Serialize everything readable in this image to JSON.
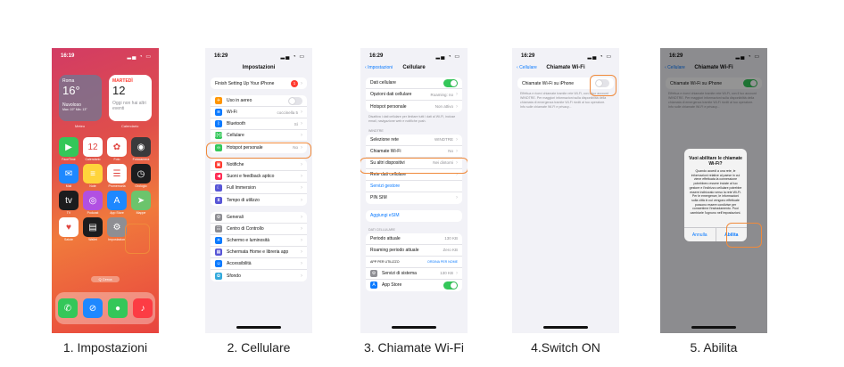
{
  "captions": [
    "1. Impostazioni",
    "2. Cellulare",
    "3. Chiamate Wi-Fi",
    "4.Switch ON",
    "5. Abilita"
  ],
  "time": "16:29",
  "time_home": "16:19",
  "highlight_color": "#f08a3b",
  "home": {
    "weather_city": "Roma",
    "weather_temp": "16°",
    "weather_cond": "Nuvoloso",
    "weather_range": "Max: 19° Min: 13°",
    "weather_label": "Meteo",
    "cal_day": "MARTEDÌ",
    "cal_date": "12",
    "cal_text": "Oggi non hai altri eventi",
    "cal_label": "Calendario",
    "apps": [
      {
        "name": "FaceTime",
        "icon": "facetime-icon",
        "color": "#34c759",
        "glyph": "▶"
      },
      {
        "name": "Calendario",
        "icon": "calendar-icon",
        "color": "#ffffff",
        "glyph": "12"
      },
      {
        "name": "Foto",
        "icon": "photos-icon",
        "color": "#ffffff",
        "glyph": "✿"
      },
      {
        "name": "Fotocamera",
        "icon": "camera-icon",
        "color": "#3a3a3c",
        "glyph": "◉"
      },
      {
        "name": "Mail",
        "icon": "mail-icon",
        "color": "#1e88ff",
        "glyph": "✉"
      },
      {
        "name": "Note",
        "icon": "notes-icon",
        "color": "#ffd43b",
        "glyph": "≡"
      },
      {
        "name": "Promemoria",
        "icon": "reminders-icon",
        "color": "#ffffff",
        "glyph": "☰"
      },
      {
        "name": "Orologio",
        "icon": "clock-icon",
        "color": "#1c1c1e",
        "glyph": "◷"
      },
      {
        "name": "TV",
        "icon": "tv-icon",
        "color": "#1c1c1e",
        "glyph": "tv"
      },
      {
        "name": "Podcast",
        "icon": "podcast-icon",
        "color": "#b150e2",
        "glyph": "◎"
      },
      {
        "name": "App Store",
        "icon": "appstore-icon",
        "color": "#1e88ff",
        "glyph": "A"
      },
      {
        "name": "Mappe",
        "icon": "maps-icon",
        "color": "#6cc46c",
        "glyph": "➤"
      },
      {
        "name": "Salute",
        "icon": "health-icon",
        "color": "#ffffff",
        "glyph": "♥"
      },
      {
        "name": "Wallet",
        "icon": "wallet-icon",
        "color": "#1c1c1e",
        "glyph": "▤"
      },
      {
        "name": "Impostazioni",
        "icon": "settings-icon",
        "color": "#8e8e93",
        "glyph": "⚙"
      }
    ],
    "search": "Q Cerca",
    "dock": [
      {
        "icon": "phone-icon",
        "color": "#34c759",
        "glyph": "✆"
      },
      {
        "icon": "safari-icon",
        "color": "#1e88ff",
        "glyph": "⊘"
      },
      {
        "icon": "messages-icon",
        "color": "#34c759",
        "glyph": "●"
      },
      {
        "icon": "music-icon",
        "color": "#fc3c44",
        "glyph": "♪"
      }
    ]
  },
  "settings": {
    "title": "Impostazioni",
    "setup": "Finish Setting Up Your iPhone",
    "setup_badge": "1",
    "rows1": [
      {
        "label": "Uso in aereo",
        "icon": "airplane-icon",
        "color": "#ff9500",
        "glyph": "✈",
        "value": "",
        "toggle": "off"
      },
      {
        "label": "Wi-Fi",
        "icon": "wifi-icon",
        "color": "#0a7aff",
        "glyph": "≋",
        "value": "coccinella 5",
        "toggle": ""
      },
      {
        "label": "Bluetooth",
        "icon": "bluetooth-icon",
        "color": "#0a7aff",
        "glyph": "ᛒ",
        "value": "Sì",
        "toggle": ""
      },
      {
        "label": "Cellulare",
        "icon": "cellular-icon",
        "color": "#34c759",
        "glyph": "((•))",
        "value": "",
        "toggle": ""
      },
      {
        "label": "Hotspot personale",
        "icon": "hotspot-icon",
        "color": "#34c759",
        "glyph": "∞",
        "value": "No",
        "toggle": ""
      }
    ],
    "rows2": [
      {
        "label": "Notifiche",
        "icon": "notifications-icon",
        "color": "#ff3b30",
        "glyph": "▣",
        "value": ""
      },
      {
        "label": "Suoni e feedback aptico",
        "icon": "sounds-icon",
        "color": "#ff2d55",
        "glyph": "◀",
        "value": ""
      },
      {
        "label": "Full Immersion",
        "icon": "focus-icon",
        "color": "#5856d6",
        "glyph": "☾",
        "value": ""
      },
      {
        "label": "Tempo di utilizzo",
        "icon": "screentime-icon",
        "color": "#5856d6",
        "glyph": "⧗",
        "value": ""
      }
    ],
    "rows3": [
      {
        "label": "Generali",
        "icon": "general-icon",
        "color": "#8e8e93",
        "glyph": "⚙",
        "value": ""
      },
      {
        "label": "Centro di Controllo",
        "icon": "control-center-icon",
        "color": "#8e8e93",
        "glyph": "☷",
        "value": ""
      },
      {
        "label": "Schermo e luminosità",
        "icon": "display-icon",
        "color": "#0a7aff",
        "glyph": "☀",
        "value": ""
      },
      {
        "label": "Schermata Home e libreria app",
        "icon": "home-screen-icon",
        "color": "#5856d6",
        "glyph": "▦",
        "value": ""
      },
      {
        "label": "Accessibilità",
        "icon": "accessibility-icon",
        "color": "#0a7aff",
        "glyph": "☺",
        "value": ""
      },
      {
        "label": "Sfondo",
        "icon": "wallpaper-icon",
        "color": "#34aadc",
        "glyph": "✿",
        "value": ""
      }
    ]
  },
  "cellular": {
    "back": "Impostazioni",
    "title": "Cellulare",
    "dati": "Dati cellulare",
    "opzioni": "Opzioni dati cellulare",
    "opzioni_val": "Roaming: no",
    "hotspot": "Hotspot personale",
    "hotspot_val": "Non attivo",
    "note": "Disattiva i dati cellulare per limitare tutti i dati al Wi-Fi, incluse email, navigazione web e notifiche push.",
    "windtre": "WINDTRE",
    "selezione": "Selezione rete",
    "selezione_val": "WINDTRE",
    "chiamate": "Chiamate Wi-Fi",
    "chiamate_val": "No",
    "altri": "Su altri dispositivi",
    "altri_val": "Nei dintorni",
    "rete": "Rete dati cellulare",
    "servizi": "Servizi gestore",
    "pin": "PIN SIM",
    "esim": "Aggiungi eSIM",
    "dati_sect": "DATI CELLULARE",
    "periodo": "Periodo attuale",
    "periodo_val": "130 KB",
    "roaming": "Roaming periodo attuale",
    "roaming_val": "Zero KB",
    "app_header": "APP PER UTILIZZO",
    "app_sort": "ORDINA PER NOME",
    "servizi_sistema": "Servizi di sistema",
    "servizi_sistema_val": "130 KB",
    "appstore": "App Store"
  },
  "wifi_calls": {
    "back": "Cellulare",
    "title": "Chiamate Wi-Fi",
    "toggle_label": "Chiamate Wi-Fi su iPhone",
    "note": "Effettua e ricevi chiamate tramite rete Wi-Fi, con il tuo account WINDTRE. Per maggiori informazioni sulla disponibilità della chiamata di emergenza tramite Wi-Fi rivolti al tuo operatore. Info sulle chiamate Wi-Fi e privacy...",
    "alert_title": "Vuoi abilitare le chiamate Wi-Fi?",
    "alert_msg": "Quando accedi a una rete, le informazioni relative al paese in cui viene effettuata la connessione potrebbero essere inviate al tuo gestore e l'indirizzo cellulare potrebbe essere indirizzato verso la rete Wi-Fi. Per le emergenze, le informazioni sulla città in cui vengono effettuate possono essere condivise per consentirne l'instradamento. Puoi cambiarle l'ognuno nell'impostazioni.",
    "alert_cancel": "Annulla",
    "alert_ok": "Abilita"
  }
}
